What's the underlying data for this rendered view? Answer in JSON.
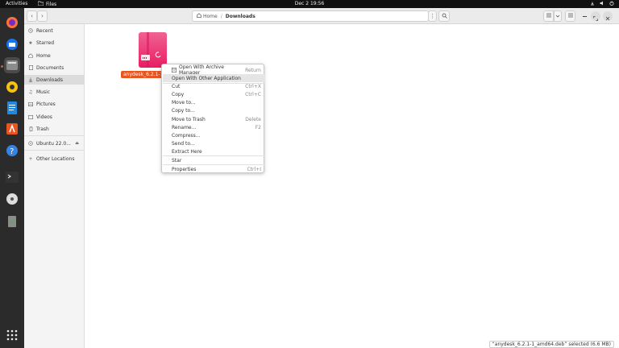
{
  "topbar": {
    "activities": "Activities",
    "app_name": "Files",
    "clock": "Dec 2  19:56"
  },
  "dock": {
    "items": [
      {
        "name": "firefox-icon"
      },
      {
        "name": "thunderbird-icon"
      },
      {
        "name": "files-icon",
        "active": true
      },
      {
        "name": "rhythmbox-icon"
      },
      {
        "name": "writer-icon"
      },
      {
        "name": "software-icon"
      },
      {
        "name": "help-icon"
      },
      {
        "name": "terminal-icon"
      },
      {
        "name": "disc-icon"
      },
      {
        "name": "trash-icon"
      },
      {
        "name": "app-grid-icon"
      }
    ]
  },
  "headerbar": {
    "path_home": "Home",
    "path_sep": "/",
    "path_current": "Downloads"
  },
  "sidebar": {
    "items": [
      {
        "label": "Recent",
        "icon": "clock-icon"
      },
      {
        "label": "Starred",
        "icon": "star-icon"
      },
      {
        "label": "Home",
        "icon": "home-icon"
      },
      {
        "label": "Documents",
        "icon": "document-icon"
      },
      {
        "label": "Downloads",
        "icon": "download-icon",
        "selected": true
      },
      {
        "label": "Music",
        "icon": "music-icon"
      },
      {
        "label": "Pictures",
        "icon": "picture-icon"
      },
      {
        "label": "Videos",
        "icon": "video-icon"
      },
      {
        "label": "Trash",
        "icon": "trash-icon"
      }
    ],
    "devices": [
      {
        "label": "Ubuntu 22.0...",
        "icon": "disc-icon"
      }
    ],
    "other": {
      "label": "Other Locations",
      "icon": "plus-icon"
    }
  },
  "file": {
    "name": "anydesk_6.2.1-1_a"
  },
  "context_menu": {
    "items": [
      {
        "label": "Open With Archive Manager",
        "accel": "Return",
        "icon": "archive-icon"
      },
      {
        "label": "Open With Other Application",
        "accel": "",
        "highlight": true
      },
      {
        "sep": true
      },
      {
        "label": "Cut",
        "accel": "Ctrl+X"
      },
      {
        "label": "Copy",
        "accel": "Ctrl+C"
      },
      {
        "label": "Move to...",
        "accel": ""
      },
      {
        "label": "Copy to...",
        "accel": ""
      },
      {
        "label": "Move to Trash",
        "accel": "Delete"
      },
      {
        "label": "Rename...",
        "accel": "F2"
      },
      {
        "label": "Compress...",
        "accel": ""
      },
      {
        "label": "Send to...",
        "accel": ""
      },
      {
        "label": "Extract Here",
        "accel": ""
      },
      {
        "sep": true
      },
      {
        "label": "Star",
        "accel": ""
      },
      {
        "sep": true
      },
      {
        "label": "Properties",
        "accel": "Ctrl+I"
      }
    ]
  },
  "status": {
    "text": "“anydesk_6.2.1-1_amd64.deb” selected  (6.6 MB)"
  }
}
